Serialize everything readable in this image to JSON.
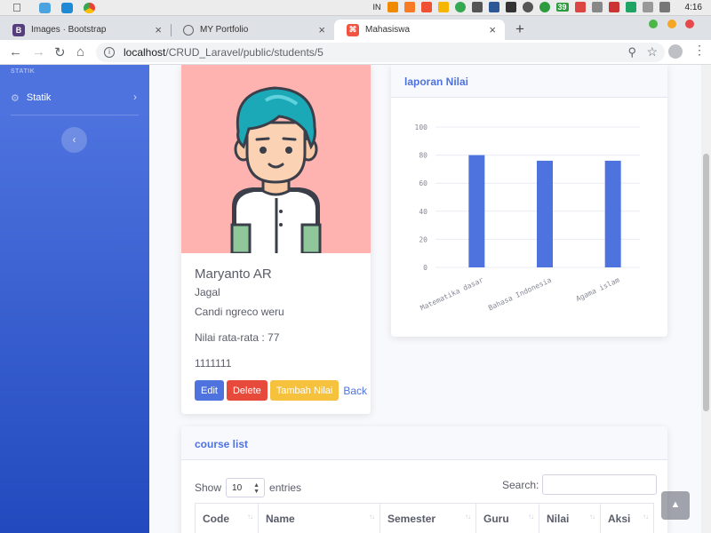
{
  "os": {
    "input_lang": "IN",
    "battery_badge": "39",
    "clock": "4:16"
  },
  "browser": {
    "tabs": [
      {
        "title": "Images · Bootstrap",
        "favicon": "bootstrap-icon"
      },
      {
        "title": "MY Portfolio",
        "favicon": "globe-icon"
      },
      {
        "title": "Mahasiswa",
        "favicon": "laravel-icon",
        "active": true
      }
    ],
    "url_host": "localhost",
    "url_path": "/CRUD_Laravel/public/students/5"
  },
  "sidebar": {
    "heading": "STATIK",
    "items": [
      {
        "label": "Statik",
        "icon": "gear-icon"
      }
    ],
    "toggle_icon": "chevron-left-icon"
  },
  "profile": {
    "name": "Maryanto AR",
    "line1": "Jagal",
    "line2": "Candi ngreco weru",
    "average": "Nilai rata-rata : 77",
    "nim": "1111111",
    "buttons": {
      "edit": "Edit",
      "delete": "Delete",
      "tambah": "Tambah Nilai",
      "back": "Back"
    }
  },
  "chart_card": {
    "title": "laporan Nilai"
  },
  "chart_data": {
    "type": "bar",
    "categories": [
      "Matematika dasar",
      "Bahasa Indonesia",
      "Agama islam"
    ],
    "values": [
      80,
      76,
      76
    ],
    "ylim": [
      0,
      100
    ],
    "yticks": [
      0,
      20,
      40,
      60,
      80,
      100
    ],
    "color": "#4e73df",
    "grid": true
  },
  "course_list": {
    "title": "course list",
    "show_label": "Show",
    "entries_value": "10",
    "entries_label": "entries",
    "search_label": "Search:",
    "columns": [
      "Code",
      "Name",
      "Semester",
      "Guru",
      "Nilai",
      "Aksi"
    ]
  }
}
